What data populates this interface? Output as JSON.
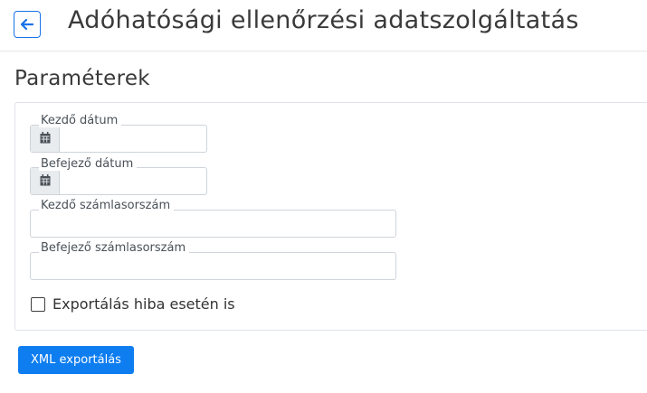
{
  "header": {
    "title": "Adóhatósági ellenőrzési adatszolgáltatás",
    "back_icon": "arrow-left-icon"
  },
  "section": {
    "title": "Paraméterek"
  },
  "form": {
    "start_date": {
      "label": "Kezdő dátum",
      "value": "",
      "icon": "calendar-icon"
    },
    "end_date": {
      "label": "Befejező dátum",
      "value": "",
      "icon": "calendar-icon"
    },
    "start_invoice": {
      "label": "Kezdő számlasorszám",
      "value": ""
    },
    "end_invoice": {
      "label": "Befejező számlasorszám",
      "value": ""
    },
    "export_on_error": {
      "label": "Exportálás hiba esetén is",
      "checked": false
    }
  },
  "actions": {
    "export_label": "XML exportálás"
  },
  "colors": {
    "accent": "#0d7df0",
    "border": "#ced4da",
    "addon_bg": "#e9ecef"
  }
}
